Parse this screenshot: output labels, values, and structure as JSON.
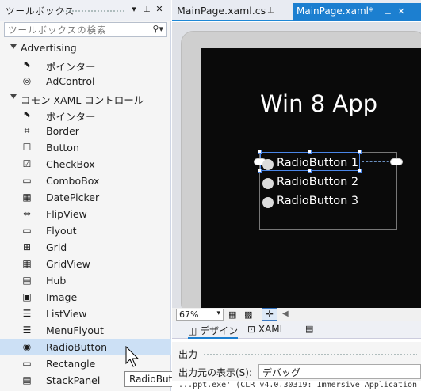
{
  "toolbox": {
    "title": "ツールボックス",
    "search_placeholder": "ツールボックスの検索",
    "categories": [
      {
        "label": "Advertising",
        "items": [
          "ポインター",
          "AdControl"
        ]
      },
      {
        "label": "コモン XAML コントロール",
        "items": [
          "ポインター",
          "Border",
          "Button",
          "CheckBox",
          "ComboBox",
          "DatePicker",
          "FlipView",
          "Flyout",
          "Grid",
          "GridView",
          "Hub",
          "Image",
          "ListView",
          "MenuFlyout",
          "RadioButton",
          "Rectangle",
          "StackPanel"
        ]
      }
    ],
    "selected_item": "RadioButton",
    "tooltip": "RadioButton"
  },
  "tabs": [
    {
      "label": "MainPage.xaml.cs",
      "active": false
    },
    {
      "label": "MainPage.xaml*",
      "active": true
    }
  ],
  "designer": {
    "app_title": "Win 8 App",
    "radio_buttons": [
      "RadioButton 1",
      "RadioButton 2",
      "RadioButton 3"
    ],
    "zoom": "67%",
    "view_tabs": {
      "design": "デザイン",
      "xaml": "XAML"
    }
  },
  "output": {
    "title": "出力",
    "source_label": "出力元の表示(S):",
    "source_value": "デバッグ",
    "text": "...ppt.exe' (CLR v4.0.30319: Immersive Application"
  },
  "colors": {
    "accent": "#1c7fd0",
    "selection": "#cce0f5"
  }
}
